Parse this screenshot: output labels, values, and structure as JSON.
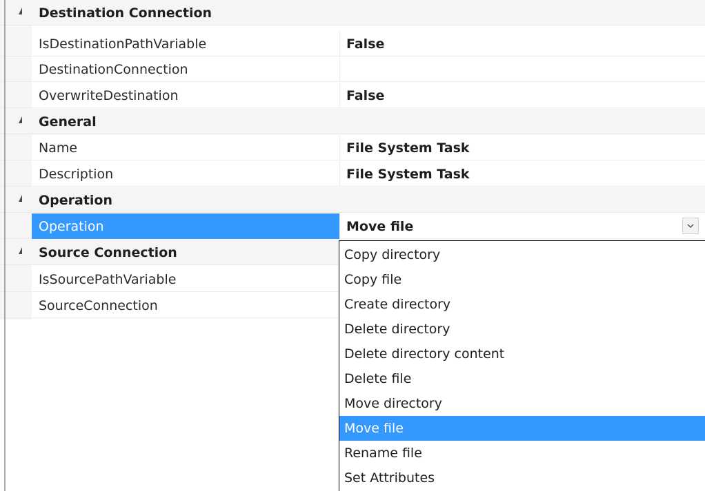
{
  "categories": [
    {
      "label": "Destination Connection",
      "properties": [
        {
          "name": "IsDestinationPathVariable",
          "value": "False"
        },
        {
          "name": "DestinationConnection",
          "value": ""
        },
        {
          "name": "OverwriteDestination",
          "value": "False"
        }
      ]
    },
    {
      "label": "General",
      "properties": [
        {
          "name": "Name",
          "value": "File System Task"
        },
        {
          "name": "Description",
          "value": "File System Task"
        }
      ]
    },
    {
      "label": "Operation",
      "properties": [
        {
          "name": "Operation",
          "value": "Move file",
          "selected": true
        }
      ]
    },
    {
      "label": "Source Connection",
      "properties": [
        {
          "name": "IsSourcePathVariable",
          "value": ""
        },
        {
          "name": "SourceConnection",
          "value": ""
        }
      ]
    }
  ],
  "dropdown": {
    "selected": "Move file",
    "options": [
      "Copy directory",
      "Copy file",
      "Create directory",
      "Delete directory",
      "Delete directory content",
      "Delete file",
      "Move directory",
      "Move file",
      "Rename file",
      "Set Attributes"
    ]
  },
  "icons": {
    "category_toggle": "collapse-triangle-icon",
    "dropdown_button": "chevron-down-icon"
  },
  "colors": {
    "selection": "#3399ff",
    "category_background": "#f5f5f5"
  }
}
